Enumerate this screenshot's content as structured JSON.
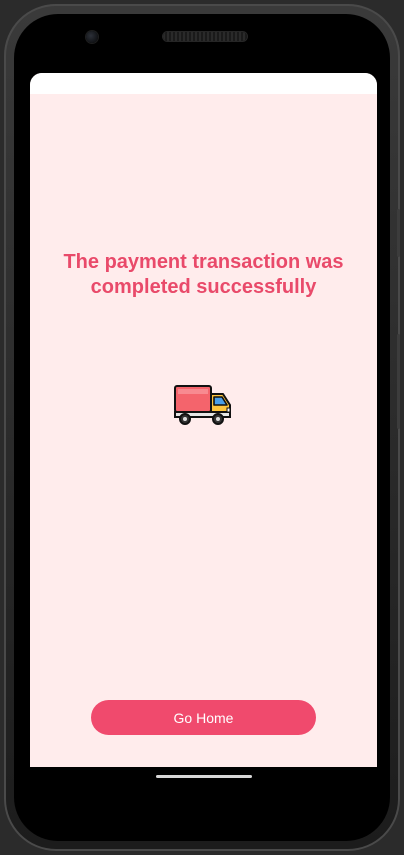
{
  "screen": {
    "title": "The payment transaction was completed successfully",
    "illustration_icon": "delivery-truck-icon",
    "go_home_label": "Go Home"
  },
  "colors": {
    "background": "#ffecec",
    "accent": "#f04a6d",
    "title_text": "#e94a6a",
    "button_text": "#ffffff"
  }
}
